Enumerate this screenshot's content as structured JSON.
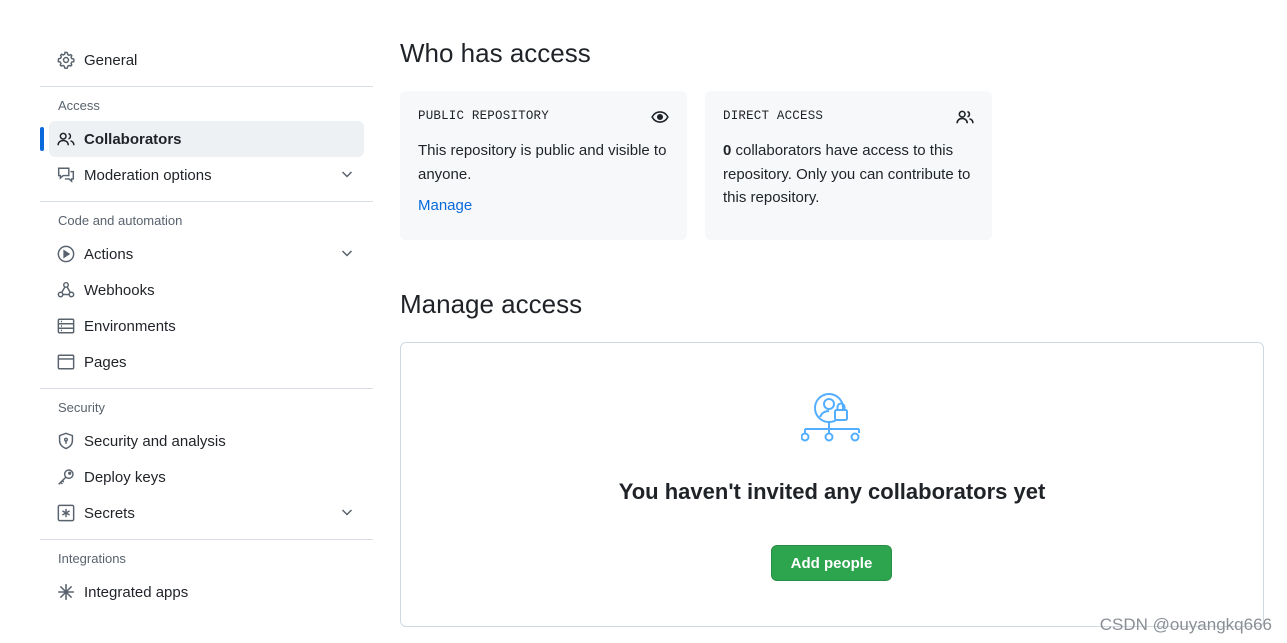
{
  "sidebar": {
    "general": {
      "label": "General",
      "icon": "gear-icon"
    },
    "groups": {
      "access": {
        "heading": "Access",
        "collaborators": {
          "label": "Collaborators",
          "icon": "people-icon"
        },
        "moderation": {
          "label": "Moderation options",
          "icon": "comment-discussion-icon"
        }
      },
      "code": {
        "heading": "Code and automation",
        "actions": {
          "label": "Actions",
          "icon": "play-icon"
        },
        "webhooks": {
          "label": "Webhooks",
          "icon": "webhook-icon"
        },
        "environments": {
          "label": "Environments",
          "icon": "server-icon"
        },
        "pages": {
          "label": "Pages",
          "icon": "browser-icon"
        }
      },
      "security": {
        "heading": "Security",
        "analysis": {
          "label": "Security and analysis",
          "icon": "shield-icon"
        },
        "deploy_keys": {
          "label": "Deploy keys",
          "icon": "key-icon"
        },
        "secrets": {
          "label": "Secrets",
          "icon": "asterisk-icon"
        }
      },
      "integrations": {
        "heading": "Integrations",
        "apps": {
          "label": "Integrated apps",
          "icon": "apps-icon"
        }
      }
    }
  },
  "main": {
    "who_title": "Who has access",
    "public_card": {
      "caption": "PUBLIC REPOSITORY",
      "text": "This repository is public and visible to anyone.",
      "link": "Manage",
      "icon": "eye-icon"
    },
    "direct_card": {
      "caption": "DIRECT ACCESS",
      "count": "0",
      "text": " collaborators have access to this repository. Only you can contribute to this repository.",
      "icon": "people-icon"
    },
    "manage_title": "Manage access",
    "empty_text": "You haven't invited any collaborators yet",
    "add_button": "Add people"
  },
  "watermark": "CSDN @ouyangkq666",
  "colors": {
    "accent": "#0969da",
    "button_green": "#2da44e",
    "card_bg": "#f6f8fa",
    "active_bg": "#eef1f4",
    "illustration": "#54aeff"
  }
}
